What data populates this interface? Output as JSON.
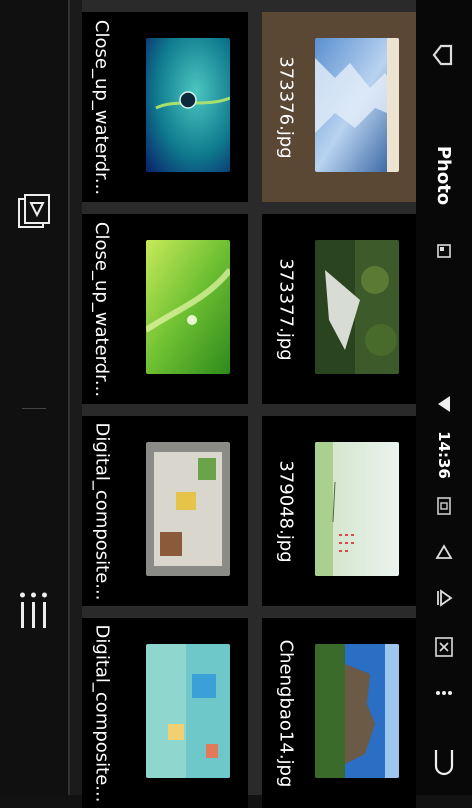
{
  "app": {
    "title": "Photo",
    "clock": "14:36"
  },
  "colors": {
    "background": "#121212",
    "selected": "#5a4734",
    "tile": "#000000",
    "text": "#ffffff"
  },
  "right_rail": {
    "icons": [
      "back-arrow-icon",
      "image-icon",
      "wifi-icon",
      "battery-icon",
      "triangle-icon",
      "skip-icon",
      "close-box-icon",
      "more-icon",
      "return-icon"
    ]
  },
  "left_nav": {
    "icons": [
      "album-play-icon",
      "menu-grid-icon"
    ]
  },
  "gallery": {
    "items": [
      {
        "name": "373376.jpg",
        "selected": true
      },
      {
        "name": "373377.jpg",
        "selected": false
      },
      {
        "name": "379048.jpg",
        "selected": false
      },
      {
        "name": "Chengbao14.jpg",
        "selected": false
      },
      {
        "name": "Close_up_waterdr...",
        "selected": false
      },
      {
        "name": "Close_up_waterdr...",
        "selected": false
      },
      {
        "name": "Digital_composite...",
        "selected": false
      },
      {
        "name": "Digital_composite...",
        "selected": false
      }
    ]
  }
}
